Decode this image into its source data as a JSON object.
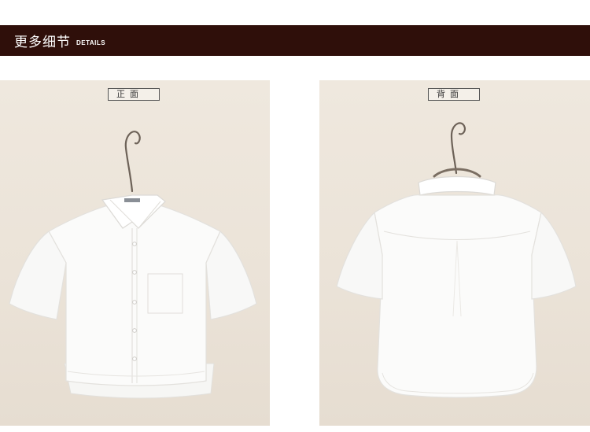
{
  "header": {
    "title": "更多细节",
    "subtitle": "DETAILS",
    "background_color": "#2f0f0a"
  },
  "views": {
    "front_label": "正面",
    "back_label": "背面"
  }
}
